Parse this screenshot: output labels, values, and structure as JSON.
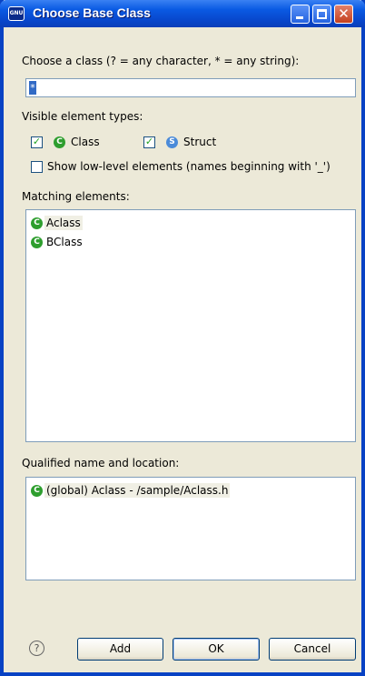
{
  "window": {
    "title": "Choose Base Class",
    "app_icon_text": "GNU",
    "minimize_icon": "minimize-icon",
    "maximize_icon": "maximize-icon",
    "close_icon": "close-icon",
    "close_glyph": "✕"
  },
  "filter": {
    "label": "Choose a class (? = any character, * = any string):",
    "value": "*"
  },
  "types": {
    "label": "Visible element types:",
    "class_label": "Class",
    "class_checked": true,
    "struct_label": "Struct",
    "struct_checked": true,
    "class_icon": "C",
    "struct_icon": "S",
    "check_glyph": "✓",
    "low_level_label": "Show low-level elements (names beginning with '_')",
    "low_level_checked": false
  },
  "matching": {
    "label": "Matching elements:",
    "items": [
      {
        "icon": "C",
        "label": "Aclass",
        "selected": true
      },
      {
        "icon": "C",
        "label": "BClass",
        "selected": false
      }
    ]
  },
  "qualified": {
    "label": "Qualified name and location:",
    "items": [
      {
        "icon": "C",
        "label": "(global) Aclass - /sample/Aclass.h",
        "selected": true
      }
    ]
  },
  "footer": {
    "help_glyph": "?",
    "add_label": "Add",
    "ok_label": "OK",
    "cancel_label": "Cancel"
  },
  "colors": {
    "title_bar": "#0a5ae3",
    "class_icon": "#2e9e2e",
    "struct_icon": "#4b8bd9",
    "selection": "#316ac5"
  }
}
